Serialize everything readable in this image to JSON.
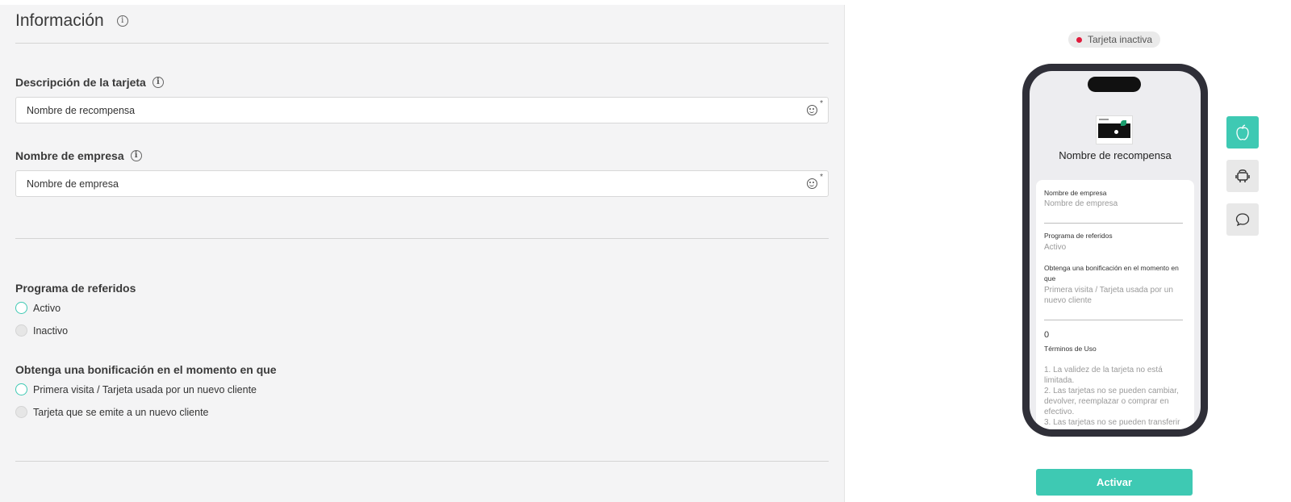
{
  "form": {
    "section_title": "Información",
    "description": {
      "label": "Descripción de la tarjeta",
      "value": "Nombre de recompensa",
      "required_mark": "*"
    },
    "company": {
      "label": "Nombre de empresa",
      "value": "Nombre de empresa",
      "required_mark": "*"
    },
    "referral": {
      "label": "Programa de referidos",
      "options": [
        {
          "label": "Activo",
          "selected": true
        },
        {
          "label": "Inactivo",
          "selected": false
        }
      ]
    },
    "bonus": {
      "label": "Obtenga una bonificación en el momento en que",
      "options": [
        {
          "label": "Primera visita / Tarjeta usada por un nuevo cliente",
          "selected": true
        },
        {
          "label": "Tarjeta que se emite a un nuevo cliente",
          "selected": false
        }
      ]
    }
  },
  "preview": {
    "status": {
      "label": "Tarjeta inactiva",
      "color": "#e01b3c"
    },
    "card_title": "Nombre de recompensa",
    "fields": {
      "company_label": "Nombre de empresa",
      "company_value": "Nombre de empresa",
      "referral_label": "Programa de referidos",
      "referral_value": "Activo",
      "bonus_label": "Obtenga una bonificación en el momento en que",
      "bonus_value": "Primera visita / Tarjeta usada por un nuevo cliente",
      "count": "0",
      "terms_label": "Términos de Uso",
      "terms_text": "1. La validez de la tarjeta no está limitada.\n2. Las tarjetas no se pueden cambiar, devolver, reemplazar o comprar en efectivo.\n3. Las tarjetas no se pueden transferir"
    },
    "activate_label": "Activar",
    "platforms": [
      {
        "icon": "apple-icon",
        "active": true
      },
      {
        "icon": "android-icon",
        "active": false
      },
      {
        "icon": "chat-icon",
        "active": false
      }
    ]
  },
  "colors": {
    "accent": "#3ec9b3",
    "inactive_dot": "#e01b3c"
  }
}
